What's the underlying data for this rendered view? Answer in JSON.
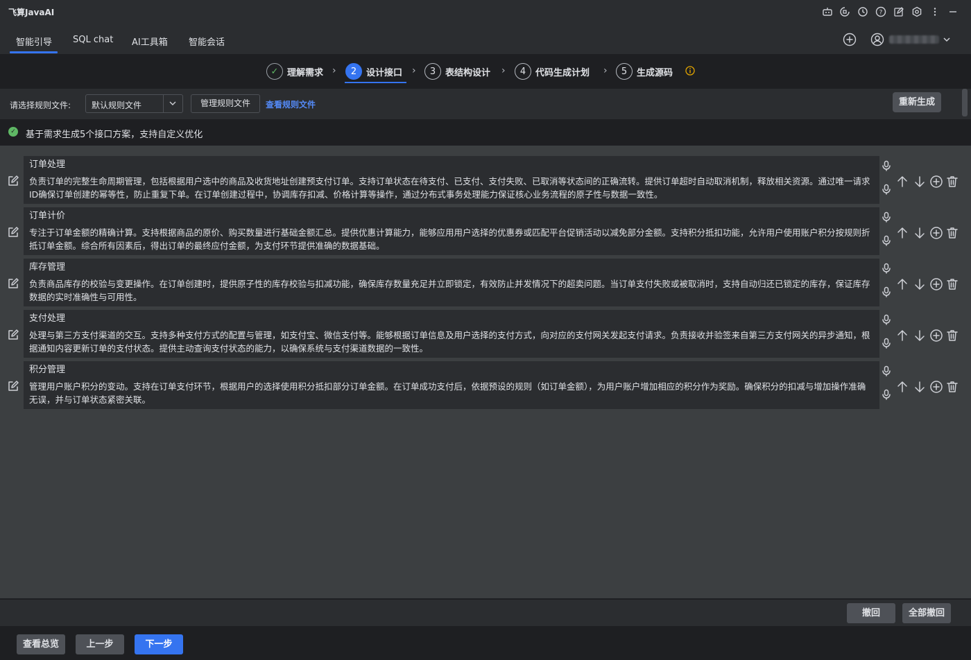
{
  "app": {
    "title": "飞算JavaAI"
  },
  "titlebar_icons": [
    "robot-icon",
    "plugin-icon",
    "history-icon",
    "help-icon",
    "edit-icon",
    "settings-icon",
    "more-icon",
    "minimize-icon"
  ],
  "tabs": [
    {
      "label": "智能引导",
      "active": true
    },
    {
      "label": "SQL chat",
      "active": false
    },
    {
      "label": "AI工具箱",
      "active": false
    },
    {
      "label": "智能会话",
      "active": false
    }
  ],
  "steps": [
    {
      "number": "✓",
      "label": "理解需求",
      "state": "done"
    },
    {
      "number": "2",
      "label": "设计接口",
      "state": "active"
    },
    {
      "number": "3",
      "label": "表结构设计",
      "state": "pending"
    },
    {
      "number": "4",
      "label": "代码生成计划",
      "state": "pending"
    },
    {
      "number": "5",
      "label": "生成源码",
      "state": "pending"
    }
  ],
  "rules": {
    "label": "请选择规则文件:",
    "selected": "默认规则文件",
    "manage_button": "管理规则文件",
    "view_link": "查看规则文件",
    "regenerate_button": "重新生成"
  },
  "status": {
    "text": "基于需求生成5个接口方案，支持自定义优化",
    "color": "#5fb865"
  },
  "interfaces": [
    {
      "title": "订单处理",
      "description": "负责订单的完整生命周期管理，包括根据用户选中的商品及收货地址创建预支付订单。支持订单状态在待支付、已支付、支付失败、已取消等状态间的正确流转。提供订单超时自动取消机制，释放相关资源。通过唯一请求ID确保订单创建的幂等性，防止重复下单。在订单创建过程中，协调库存扣减、价格计算等操作，通过分布式事务处理能力保证核心业务流程的原子性与数据一致性。"
    },
    {
      "title": "订单计价",
      "description": "专注于订单金额的精确计算。支持根据商品的原价、购买数量进行基础金额汇总。提供优惠计算能力，能够应用用户选择的优惠券或匹配平台促销活动以减免部分金额。支持积分抵扣功能，允许用户使用账户积分按规则折抵订单金额。综合所有因素后，得出订单的最终应付金额，为支付环节提供准确的数据基础。"
    },
    {
      "title": "库存管理",
      "description": "负责商品库存的校验与变更操作。在订单创建时，提供原子性的库存校验与扣减功能，确保库存数量充足并立即锁定，有效防止并发情况下的超卖问题。当订单支付失败或被取消时，支持自动归还已锁定的库存，保证库存数据的实时准确性与可用性。"
    },
    {
      "title": "支付处理",
      "description": "处理与第三方支付渠道的交互。支持多种支付方式的配置与管理，如支付宝、微信支付等。能够根据订单信息及用户选择的支付方式，向对应的支付网关发起支付请求。负责接收并验签来自第三方支付网关的异步通知，根据通知内容更新订单的支付状态。提供主动查询支付状态的能力，以确保系统与支付渠道数据的一致性。"
    },
    {
      "title": "积分管理",
      "description": "管理用户账户积分的变动。支持在订单支付环节，根据用户的选择使用积分抵扣部分订单金额。在订单成功支付后，依据预设的规则（如订单金额），为用户账户增加相应的积分作为奖励。确保积分的扣减与增加操作准确无误，并与订单状态紧密关联。"
    }
  ],
  "undo": {
    "undo_button": "撤回",
    "undo_all_button": "全部撤回"
  },
  "footer": {
    "overview_button": "查看总览",
    "prev_button": "上一步",
    "next_button": "下一步"
  },
  "colors": {
    "accent": "#3574f0",
    "success": "#5fb865",
    "warning": "#e2a400"
  }
}
